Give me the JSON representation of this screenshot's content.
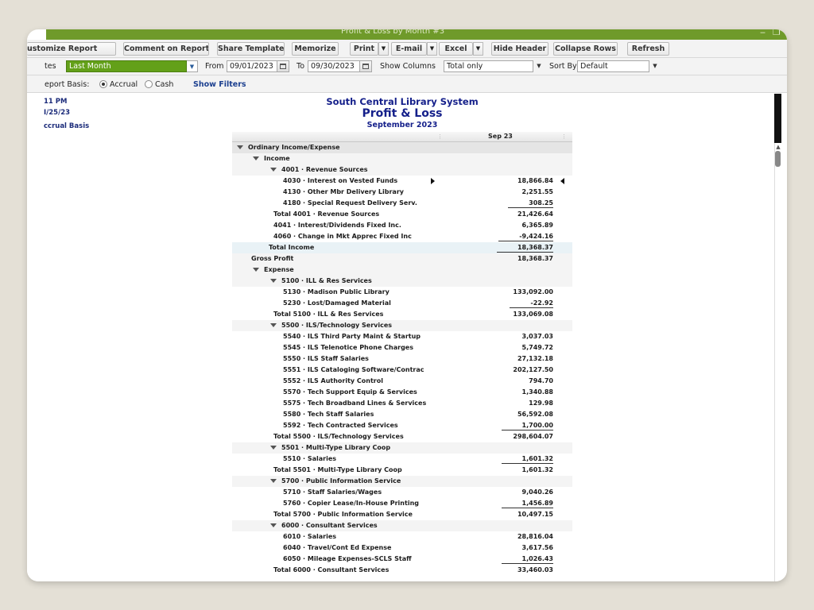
{
  "window": {
    "title": "Profit & Loss by Month #3",
    "controls": [
      "‒",
      "❐",
      "✕"
    ]
  },
  "toolbar": {
    "customize": "ustomize Report",
    "comment": "Comment on Report",
    "share": "Share Template",
    "memorize": "Memorize",
    "print": "Print",
    "email": "E-mail",
    "excel": "Excel",
    "hide_header": "Hide Header",
    "collapse": "Collapse Rows",
    "refresh": "Refresh",
    "dropdown_glyph": "▼"
  },
  "filters": {
    "dates_label": "tes",
    "dates_value": "Last Month",
    "from_label": "From",
    "from_value": "09/01/2023",
    "to_label": "To",
    "to_value": "09/30/2023",
    "columns_label": "Show Columns",
    "columns_value": "Total only",
    "sort_label": "Sort By",
    "sort_value": "Default",
    "dropdown_glyph": "▼"
  },
  "basis": {
    "label": "eport Basis:",
    "accrual": "Accrual",
    "cash": "Cash",
    "selected": "accrual",
    "show_filters": "Show Filters"
  },
  "meta": {
    "time": "11 PM",
    "date": "I/25/23",
    "basis": "ccrual Basis"
  },
  "report": {
    "company": "South Central Library System",
    "title": "Profit & Loss",
    "period": "September 2023",
    "column": "Sep 23"
  },
  "rows": [
    {
      "label": "Ordinary Income/Expense",
      "value": "",
      "level": 0,
      "toggle": true,
      "bg": "grey"
    },
    {
      "label": "Income",
      "value": "",
      "level": 1,
      "toggle": true,
      "bg": "lgrey"
    },
    {
      "label": "4001 · Revenue Sources",
      "value": "",
      "level": 2,
      "toggle": true,
      "bg": "lgrey"
    },
    {
      "label": "4030 · Interest on Vested Funds",
      "value": "18,866.84",
      "level": 4,
      "marker": true
    },
    {
      "label": "4130 · Other Mbr Delivery Library",
      "value": "2,251.55",
      "level": 4
    },
    {
      "label": "4180 · Special Request Delivery Serv.",
      "value": "308.25",
      "level": 4,
      "style": "ul"
    },
    {
      "label": "Total 4001 · Revenue Sources",
      "value": "21,426.64",
      "level": 3
    },
    {
      "label": "4041 · Interest/Dividends Fixed Inc.",
      "value": "6,365.89",
      "level": 3
    },
    {
      "label": "4060 · Change in Mkt Apprec Fixed Inc",
      "value": "-9,424.16",
      "level": 3,
      "style": "ul"
    },
    {
      "label": "Total Income",
      "value": "18,368.37",
      "level": 2,
      "bg": "blue",
      "style": "ul"
    },
    {
      "label": "Gross Profit",
      "value": "18,368.37",
      "level": 1,
      "bg": "lgrey"
    },
    {
      "label": "Expense",
      "value": "",
      "level": 1,
      "toggle": true,
      "bg": "lgrey"
    },
    {
      "label": "5100 · ILL & Res Services",
      "value": "",
      "level": 2,
      "toggle": true,
      "bg": "lgrey"
    },
    {
      "label": "5130 · Madison Public Library",
      "value": "133,092.00",
      "level": 4
    },
    {
      "label": "5230 · Lost/Damaged Material",
      "value": "-22.92",
      "level": 4,
      "style": "ul"
    },
    {
      "label": "Total 5100 · ILL & Res Services",
      "value": "133,069.08",
      "level": 3
    },
    {
      "label": "5500 · ILS/Technology Services",
      "value": "",
      "level": 2,
      "toggle": true,
      "bg": "lgrey"
    },
    {
      "label": "5540 · ILS Third Party Maint & Startup",
      "value": "3,037.03",
      "level": 4
    },
    {
      "label": "5545 · ILS Telenotice Phone Charges",
      "value": "5,749.72",
      "level": 4
    },
    {
      "label": "5550 · ILS Staff Salaries",
      "value": "27,132.18",
      "level": 4
    },
    {
      "label": "5551 · ILS Cataloging Software/Contrac",
      "value": "202,127.50",
      "level": 4
    },
    {
      "label": "5552 · ILS Authority  Control",
      "value": "794.70",
      "level": 4
    },
    {
      "label": "5570 · Tech Support Equip & Services",
      "value": "1,340.88",
      "level": 4
    },
    {
      "label": "5575 · Tech Broadband Lines & Services",
      "value": "129.98",
      "level": 4
    },
    {
      "label": "5580 · Tech Staff Salaries",
      "value": "56,592.08",
      "level": 4
    },
    {
      "label": "5592 · Tech Contracted Services",
      "value": "1,700.00",
      "level": 4,
      "style": "ul"
    },
    {
      "label": "Total 5500 · ILS/Technology Services",
      "value": "298,604.07",
      "level": 3
    },
    {
      "label": "5501 · Multi-Type Library Coop",
      "value": "",
      "level": 2,
      "toggle": true,
      "bg": "lgrey"
    },
    {
      "label": "5510 · Salaries",
      "value": "1,601.32",
      "level": 4,
      "style": "ul"
    },
    {
      "label": "Total 5501 · Multi-Type Library Coop",
      "value": "1,601.32",
      "level": 3
    },
    {
      "label": "5700 · Public Information Service",
      "value": "",
      "level": 2,
      "toggle": true,
      "bg": "lgrey"
    },
    {
      "label": "5710 · Staff Salaries/Wages",
      "value": "9,040.26",
      "level": 4
    },
    {
      "label": "5760 · Copier Lease/In-House Printing",
      "value": "1,456.89",
      "level": 4,
      "style": "ul"
    },
    {
      "label": "Total 5700 · Public Information Service",
      "value": "10,497.15",
      "level": 3
    },
    {
      "label": "6000 · Consultant Services",
      "value": "",
      "level": 2,
      "toggle": true,
      "bg": "lgrey"
    },
    {
      "label": "6010 · Salaries",
      "value": "28,816.04",
      "level": 4
    },
    {
      "label": "6040 · Travel/Cont Ed Expense",
      "value": "3,617.56",
      "level": 4
    },
    {
      "label": "6050 · Mileage Expenses-SCLS Staff",
      "value": "1,026.43",
      "level": 4,
      "style": "ul"
    },
    {
      "label": "Total 6000 · Consultant Services",
      "value": "33,460.03",
      "level": 3
    }
  ]
}
